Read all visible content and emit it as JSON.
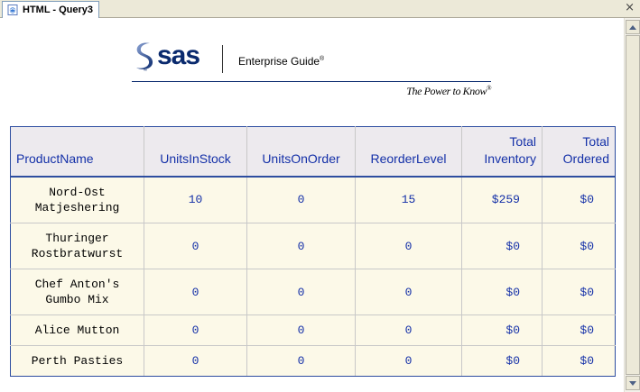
{
  "tab": {
    "title": "HTML - Query3",
    "icon": "html-document-icon",
    "close_label": "×"
  },
  "banner": {
    "logo_text": "sas",
    "logo_icon": "sas-swirl-icon",
    "product": "Enterprise Guide",
    "product_mark": "®",
    "tagline": "The Power to Know",
    "tagline_mark": "®"
  },
  "table": {
    "columns": [
      "ProductName",
      "UnitsInStock",
      "UnitsOnOrder",
      "ReorderLevel",
      "Total Inventory",
      "Total Ordered"
    ],
    "rows": [
      {
        "name_line1": "Nord-Ost",
        "name_line2": "Matjeshering",
        "units_in_stock": "10",
        "units_on_order": "0",
        "reorder_level": "15",
        "total_inventory": "$259",
        "total_ordered": "$0"
      },
      {
        "name_line1": "Thuringer",
        "name_line2": "Rostbratwurst",
        "units_in_stock": "0",
        "units_on_order": "0",
        "reorder_level": "0",
        "total_inventory": "$0",
        "total_ordered": "$0"
      },
      {
        "name_line1": "Chef Anton's",
        "name_line2": "Gumbo Mix",
        "units_in_stock": "0",
        "units_on_order": "0",
        "reorder_level": "0",
        "total_inventory": "$0",
        "total_ordered": "$0"
      },
      {
        "name_line1": "Alice Mutton",
        "name_line2": "",
        "units_in_stock": "0",
        "units_on_order": "0",
        "reorder_level": "0",
        "total_inventory": "$0",
        "total_ordered": "$0"
      },
      {
        "name_line1": "Perth Pasties",
        "name_line2": "",
        "units_in_stock": "0",
        "units_on_order": "0",
        "reorder_level": "0",
        "total_inventory": "$0",
        "total_ordered": "$0"
      }
    ]
  },
  "colors": {
    "header_text": "#1430a8",
    "header_bg": "#edeaee",
    "cell_bg": "#fcf9e8",
    "table_border": "#2d4da0"
  }
}
